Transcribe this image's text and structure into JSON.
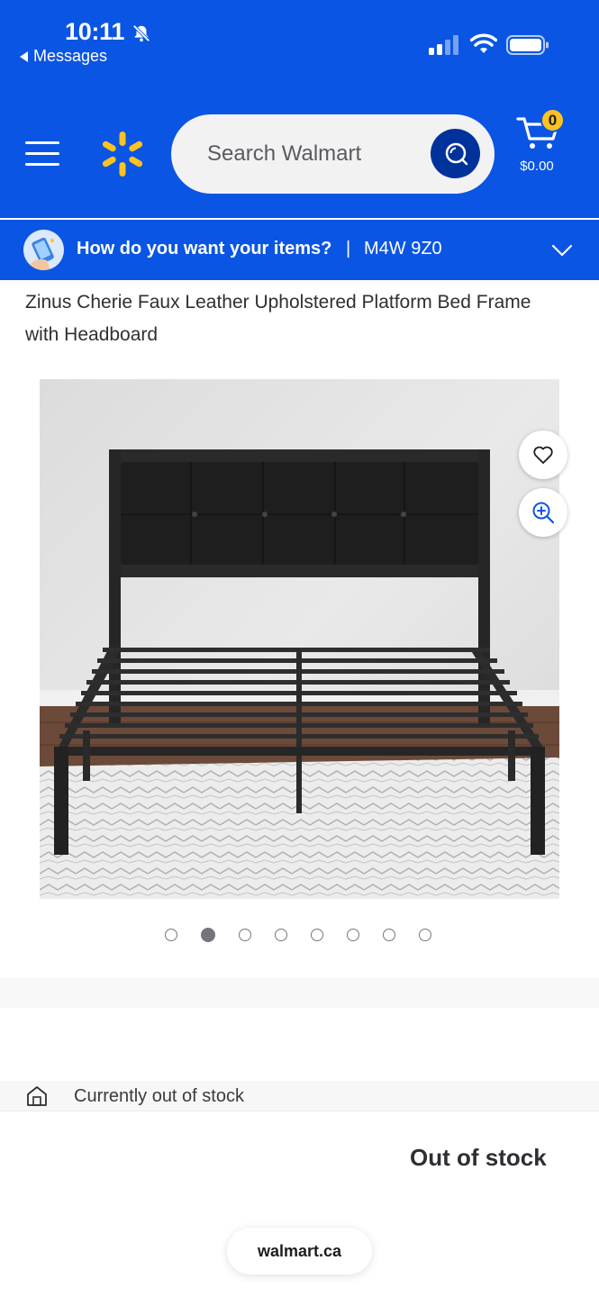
{
  "status_bar": {
    "time": "10:11",
    "back_app": "Messages"
  },
  "header": {
    "search_placeholder": "Search Walmart",
    "cart_count": "0",
    "cart_total": "$0.00",
    "brand_color": "#0a55e3",
    "spark_color": "#ffc220"
  },
  "delivery": {
    "question": "How do you want your items?",
    "separator": "|",
    "postal_code": "M4W 9Z0"
  },
  "product": {
    "title": "Zinus Cherie Faux Leather Upholstered Platform Bed Frame with Headboard",
    "image_count": 8,
    "active_image_index": 1,
    "stock_notice": "Currently out of stock",
    "availability": "Out of stock"
  },
  "browser": {
    "domain": "walmart.ca"
  }
}
